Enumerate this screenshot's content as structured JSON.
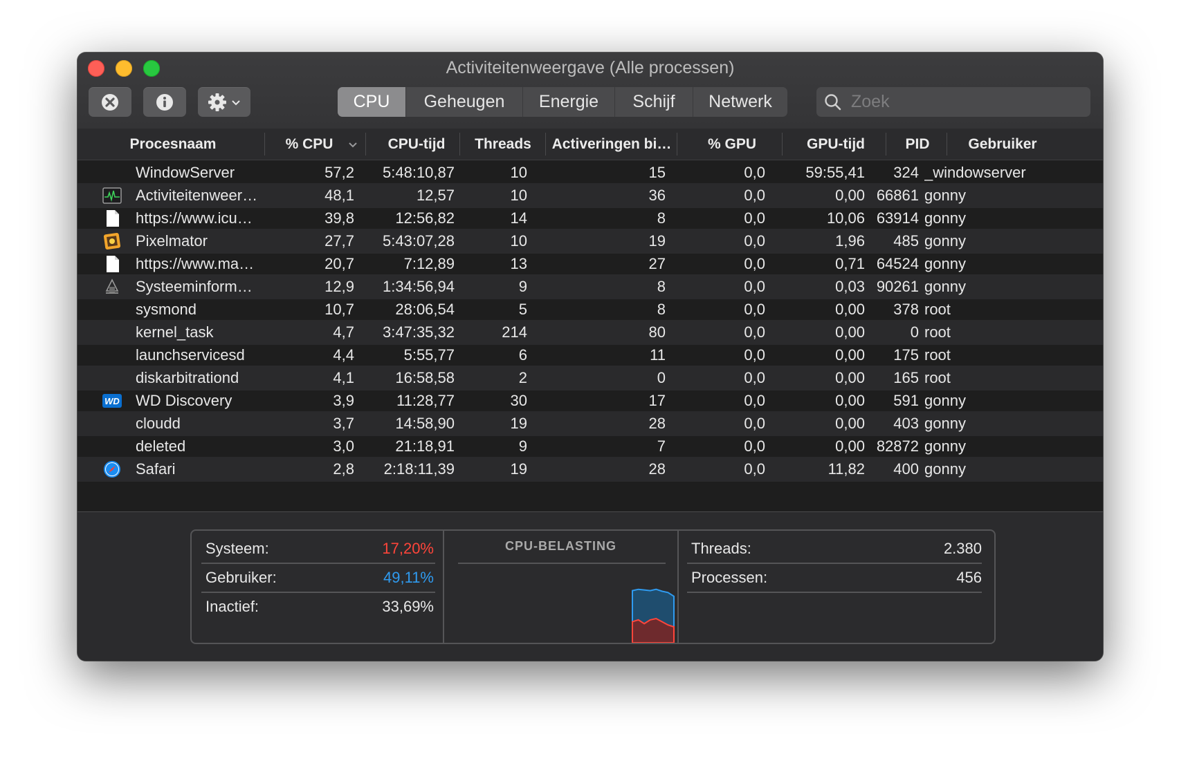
{
  "window": {
    "title": "Activiteitenweergave (Alle processen)"
  },
  "toolbar": {
    "tabs": [
      "CPU",
      "Geheugen",
      "Energie",
      "Schijf",
      "Netwerk"
    ],
    "active_tab": "CPU",
    "search_placeholder": "Zoek"
  },
  "columns": [
    "Procesnaam",
    "% CPU",
    "CPU-tijd",
    "Threads",
    "Activeringen bi…",
    "% GPU",
    "GPU-tijd",
    "PID",
    "Gebruiker"
  ],
  "sort_column": "% CPU",
  "rows": [
    {
      "name": "WindowServer",
      "cpu": "57,2",
      "cpu_time": "5:48:10,87",
      "threads": "10",
      "wakeups": "15",
      "gpu": "0,0",
      "gpu_time": "59:55,41",
      "pid": "324",
      "user": "_windowserver",
      "icon": ""
    },
    {
      "name": "Activiteitenweer…",
      "cpu": "48,1",
      "cpu_time": "12,57",
      "threads": "10",
      "wakeups": "36",
      "gpu": "0,0",
      "gpu_time": "0,00",
      "pid": "66861",
      "user": "gonny",
      "icon": "activity-monitor-icon"
    },
    {
      "name": "https://www.icu…",
      "cpu": "39,8",
      "cpu_time": "12:56,82",
      "threads": "14",
      "wakeups": "8",
      "gpu": "0,0",
      "gpu_time": "10,06",
      "pid": "63914",
      "user": "gonny",
      "icon": "document-icon"
    },
    {
      "name": "Pixelmator",
      "cpu": "27,7",
      "cpu_time": "5:43:07,28",
      "threads": "10",
      "wakeups": "19",
      "gpu": "0,0",
      "gpu_time": "1,96",
      "pid": "485",
      "user": "gonny",
      "icon": "pixelmator-icon"
    },
    {
      "name": "https://www.ma…",
      "cpu": "20,7",
      "cpu_time": "7:12,89",
      "threads": "13",
      "wakeups": "27",
      "gpu": "0,0",
      "gpu_time": "0,71",
      "pid": "64524",
      "user": "gonny",
      "icon": "document-icon"
    },
    {
      "name": "Systeeminform…",
      "cpu": "12,9",
      "cpu_time": "1:34:56,94",
      "threads": "9",
      "wakeups": "8",
      "gpu": "0,0",
      "gpu_time": "0,03",
      "pid": "90261",
      "user": "gonny",
      "icon": "system-information-icon"
    },
    {
      "name": "sysmond",
      "cpu": "10,7",
      "cpu_time": "28:06,54",
      "threads": "5",
      "wakeups": "8",
      "gpu": "0,0",
      "gpu_time": "0,00",
      "pid": "378",
      "user": "root",
      "icon": ""
    },
    {
      "name": "kernel_task",
      "cpu": "4,7",
      "cpu_time": "3:47:35,32",
      "threads": "214",
      "wakeups": "80",
      "gpu": "0,0",
      "gpu_time": "0,00",
      "pid": "0",
      "user": "root",
      "icon": ""
    },
    {
      "name": "launchservicesd",
      "cpu": "4,4",
      "cpu_time": "5:55,77",
      "threads": "6",
      "wakeups": "11",
      "gpu": "0,0",
      "gpu_time": "0,00",
      "pid": "175",
      "user": "root",
      "icon": ""
    },
    {
      "name": "diskarbitrationd",
      "cpu": "4,1",
      "cpu_time": "16:58,58",
      "threads": "2",
      "wakeups": "0",
      "gpu": "0,0",
      "gpu_time": "0,00",
      "pid": "165",
      "user": "root",
      "icon": ""
    },
    {
      "name": "WD Discovery",
      "cpu": "3,9",
      "cpu_time": "11:28,77",
      "threads": "30",
      "wakeups": "17",
      "gpu": "0,0",
      "gpu_time": "0,00",
      "pid": "591",
      "user": "gonny",
      "icon": "wd-discovery-icon"
    },
    {
      "name": "cloudd",
      "cpu": "3,7",
      "cpu_time": "14:58,90",
      "threads": "19",
      "wakeups": "28",
      "gpu": "0,0",
      "gpu_time": "0,00",
      "pid": "403",
      "user": "gonny",
      "icon": ""
    },
    {
      "name": "deleted",
      "cpu": "3,0",
      "cpu_time": "21:18,91",
      "threads": "9",
      "wakeups": "7",
      "gpu": "0,0",
      "gpu_time": "0,00",
      "pid": "82872",
      "user": "gonny",
      "icon": ""
    },
    {
      "name": "Safari",
      "cpu": "2,8",
      "cpu_time": "2:18:11,39",
      "threads": "19",
      "wakeups": "28",
      "gpu": "0,0",
      "gpu_time": "11,82",
      "pid": "400",
      "user": "gonny",
      "icon": "safari-icon"
    }
  ],
  "stats": {
    "system_label": "Systeem:",
    "system_value": "17,20%",
    "user_label": "Gebruiker:",
    "user_value": "49,11%",
    "idle_label": "Inactief:",
    "idle_value": "33,69%",
    "threads_label": "Threads:",
    "threads_value": "2.380",
    "processes_label": "Processen:",
    "processes_value": "456"
  },
  "cpu_chart": {
    "title": "CPU-BELASTING",
    "user_series": [
      0.82,
      0.84,
      0.83,
      0.82,
      0.84,
      0.81,
      0.79,
      0.73
    ],
    "system_series": [
      0.33,
      0.36,
      0.3,
      0.36,
      0.38,
      0.33,
      0.28,
      0.25
    ]
  },
  "colors": {
    "system": "#ff453a",
    "user": "#2f9bf0",
    "chart_user_fill": "#1f4d6e",
    "chart_system_fill": "#6e2a2d"
  }
}
